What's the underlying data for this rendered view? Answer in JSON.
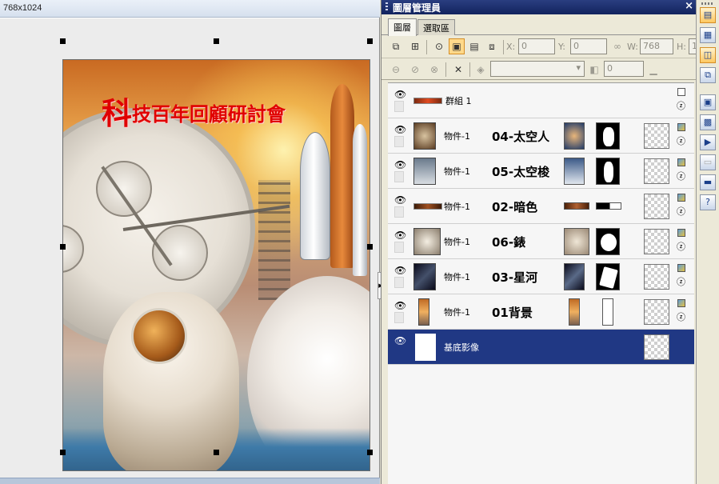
{
  "document": {
    "title": "768x1024",
    "poster": {
      "title_first_char": "科",
      "title_rest": "技百年回顧研討會"
    }
  },
  "layer_manager": {
    "title": "圖層管理員",
    "close_glyph": "×",
    "tabs": [
      {
        "label": "圖層",
        "active": true
      },
      {
        "label": "選取區",
        "active": false
      }
    ],
    "position": {
      "x_label": "X:",
      "x_value": "0",
      "y_label": "Y:",
      "y_value": "0",
      "w_label": "W:",
      "w_value": "768",
      "h_label": "H:",
      "h_value": "1"
    },
    "opacity_value": "0",
    "layers": [
      {
        "name": "群組 1",
        "tag": "",
        "selected": false
      },
      {
        "name": "物件-1",
        "tag": "04-太空人",
        "selected": false
      },
      {
        "name": "物件-1",
        "tag": "05-太空梭",
        "selected": false
      },
      {
        "name": "物件-1",
        "tag": "02-暗色",
        "selected": false
      },
      {
        "name": "物件-1",
        "tag": "06-錶",
        "selected": false
      },
      {
        "name": "物件-1",
        "tag": "03-星河",
        "selected": false
      },
      {
        "name": "物件-1",
        "tag": "01背景",
        "selected": false
      },
      {
        "name": "基底影像",
        "tag": "",
        "selected": true
      }
    ]
  },
  "colors": {
    "panel_title": "#1b2d6e",
    "selected_row": "#203884",
    "poster_title": "#e00000"
  }
}
